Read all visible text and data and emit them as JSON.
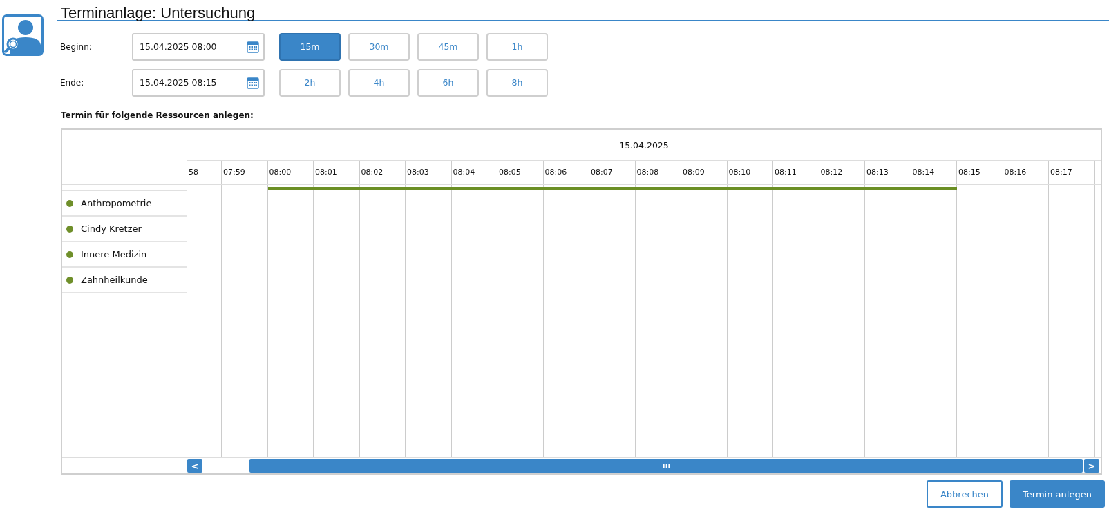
{
  "title": "Terminanlage: Untersuchung",
  "begin": {
    "label": "Beginn:",
    "value": "15.04.2025 08:00"
  },
  "end": {
    "label": "Ende:",
    "value": "15.04.2025 08:15"
  },
  "durations": [
    {
      "label": "15m",
      "selected": true
    },
    {
      "label": "30m",
      "selected": false
    },
    {
      "label": "45m",
      "selected": false
    },
    {
      "label": "1h",
      "selected": false
    },
    {
      "label": "2h",
      "selected": false
    },
    {
      "label": "4h",
      "selected": false
    },
    {
      "label": "6h",
      "selected": false
    },
    {
      "label": "8h",
      "selected": false
    }
  ],
  "resources_heading": "Termin für folgende Ressourcen anlegen:",
  "timeline": {
    "date": "15.04.2025",
    "columns": [
      {
        "label": "58",
        "booked": false
      },
      {
        "label": "07:59",
        "booked": false
      },
      {
        "label": "08:00",
        "booked": true
      },
      {
        "label": "08:01",
        "booked": true
      },
      {
        "label": "08:02",
        "booked": true
      },
      {
        "label": "08:03",
        "booked": true
      },
      {
        "label": "08:04",
        "booked": true
      },
      {
        "label": "08:05",
        "booked": true
      },
      {
        "label": "08:06",
        "booked": true
      },
      {
        "label": "08:07",
        "booked": true
      },
      {
        "label": "08:08",
        "booked": true
      },
      {
        "label": "08:09",
        "booked": true
      },
      {
        "label": "08:10",
        "booked": true
      },
      {
        "label": "08:11",
        "booked": true
      },
      {
        "label": "08:12",
        "booked": true
      },
      {
        "label": "08:13",
        "booked": true
      },
      {
        "label": "08:14",
        "booked": true
      },
      {
        "label": "08:15",
        "booked": false
      },
      {
        "label": "08:16",
        "booked": false
      },
      {
        "label": "08:17",
        "booked": false
      }
    ]
  },
  "resources": [
    {
      "name": "Anthropometrie",
      "color": "#6f8f2a"
    },
    {
      "name": "Cindy Kretzer",
      "color": "#6f8f2a"
    },
    {
      "name": "Innere Medizin",
      "color": "#6f8f2a"
    },
    {
      "name": "Zahnheilkunde",
      "color": "#6f8f2a"
    }
  ],
  "scroll_left": "<",
  "scroll_right": ">",
  "buttons": [
    {
      "label": "Abbrechen",
      "kind": "secondary"
    },
    {
      "label": "Termin anlegen",
      "kind": "primary"
    }
  ]
}
